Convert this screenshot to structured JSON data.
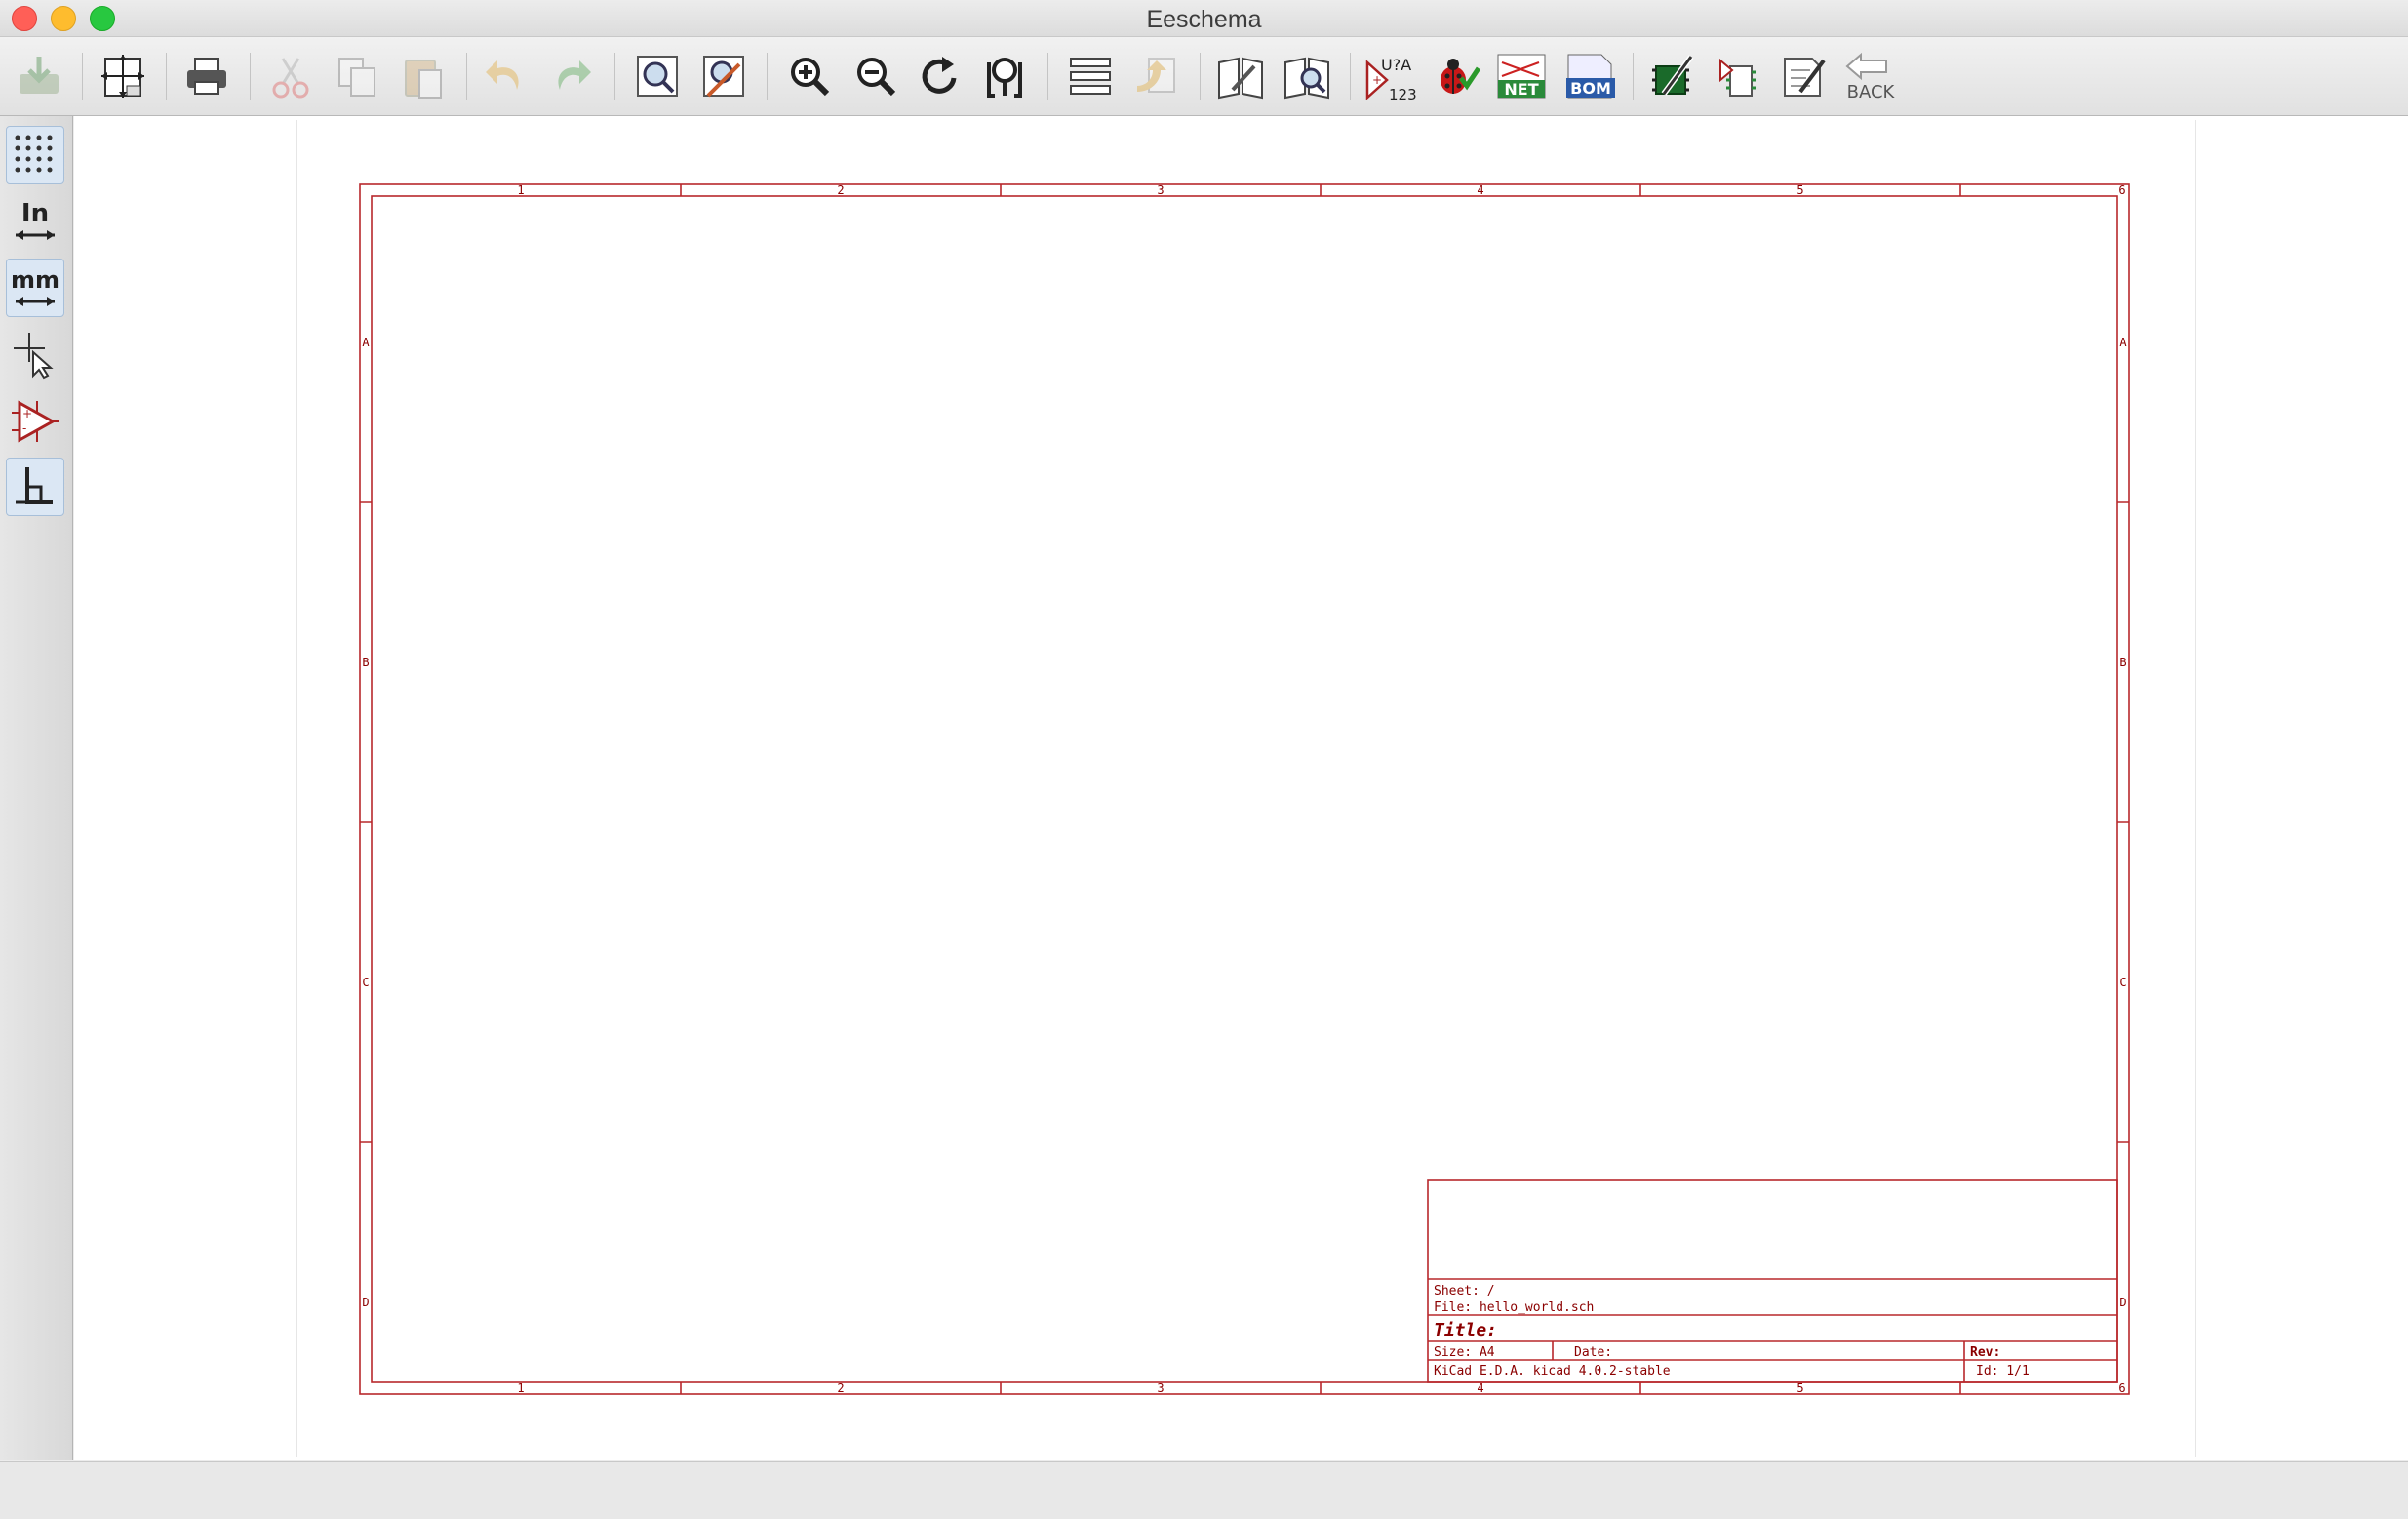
{
  "window": {
    "title": "Eeschema"
  },
  "toolbar": {
    "buttons": [
      {
        "name": "save-button",
        "icon": "save-icon",
        "disabled": true
      },
      {
        "name": "page-settings-button",
        "icon": "page-settings-icon",
        "disabled": false
      },
      {
        "name": "print-button",
        "icon": "printer-icon",
        "disabled": false
      },
      {
        "name": "cut-button",
        "icon": "scissors-icon",
        "disabled": true
      },
      {
        "name": "copy-button",
        "icon": "copy-icon",
        "disabled": true
      },
      {
        "name": "paste-button",
        "icon": "paste-icon",
        "disabled": true
      },
      {
        "name": "undo-button",
        "icon": "undo-icon",
        "disabled": true
      },
      {
        "name": "redo-button",
        "icon": "redo-icon",
        "disabled": true
      },
      {
        "name": "find-button",
        "icon": "find-icon",
        "disabled": false
      },
      {
        "name": "find-replace-button",
        "icon": "find-replace-icon",
        "disabled": false
      },
      {
        "name": "zoom-in-button",
        "icon": "zoom-in-icon",
        "disabled": false
      },
      {
        "name": "zoom-out-button",
        "icon": "zoom-out-icon",
        "disabled": false
      },
      {
        "name": "redraw-button",
        "icon": "redraw-icon",
        "disabled": false
      },
      {
        "name": "zoom-fit-button",
        "icon": "zoom-fit-icon",
        "disabled": false
      },
      {
        "name": "hierarchy-navigator-button",
        "icon": "hierarchy-icon",
        "disabled": false
      },
      {
        "name": "leave-sheet-button",
        "icon": "leave-sheet-icon",
        "disabled": true
      },
      {
        "name": "library-editor-button",
        "icon": "library-editor-icon",
        "disabled": false
      },
      {
        "name": "library-browser-button",
        "icon": "library-browser-icon",
        "disabled": false
      },
      {
        "name": "annotate-button",
        "icon": "annotate-icon",
        "disabled": false
      },
      {
        "name": "erc-button",
        "icon": "ladybug-icon",
        "disabled": false
      },
      {
        "name": "netlist-button",
        "icon": "netlist-icon",
        "disabled": false
      },
      {
        "name": "bom-button",
        "icon": "bom-icon",
        "disabled": false
      },
      {
        "name": "cvpcb-button",
        "icon": "cvpcb-icon",
        "disabled": false
      },
      {
        "name": "import-footprint-button",
        "icon": "import-footprint-icon",
        "disabled": false
      },
      {
        "name": "pcbnew-button",
        "icon": "pcbnew-icon",
        "disabled": false
      },
      {
        "name": "back-annotate-button",
        "icon": "back-icon",
        "disabled": false
      }
    ],
    "labels": {
      "annotate_top": "U?A",
      "annotate_bottom": "123",
      "net": "NET",
      "bom": "BOM",
      "back": "BACK"
    }
  },
  "left_toolbar": {
    "units_in": "In",
    "units_mm": "mm",
    "tools": [
      {
        "name": "grid-toggle",
        "icon": "grid-icon",
        "active": true
      },
      {
        "name": "units-inch-toggle",
        "icon": "inch-units-icon",
        "active": false
      },
      {
        "name": "units-mm-toggle",
        "icon": "mm-units-icon",
        "active": true
      },
      {
        "name": "cursor-shape-toggle",
        "icon": "cursor-icon",
        "active": false
      },
      {
        "name": "hidden-pins-toggle",
        "icon": "hidden-pins-icon",
        "active": false
      },
      {
        "name": "bus-wire-orient-toggle",
        "icon": "wire-orient-icon",
        "active": true
      }
    ]
  },
  "sheet": {
    "columns": [
      "1",
      "2",
      "3",
      "4",
      "5",
      "6"
    ],
    "rows": [
      "A",
      "B",
      "C",
      "D"
    ],
    "sheet_line": "Sheet: /",
    "file_line": "File: hello_world.sch",
    "title_line": "Title:",
    "size_line": "Size: A4",
    "date_line": "Date:",
    "rev_line": "Rev:",
    "kicad_line": "KiCad E.D.A.  kicad 4.0.2-stable",
    "id_line": "Id: 1/1"
  },
  "colors": {
    "frame": "#b8282c",
    "title_text": "#8b0000",
    "canvas": "#ffffff"
  }
}
